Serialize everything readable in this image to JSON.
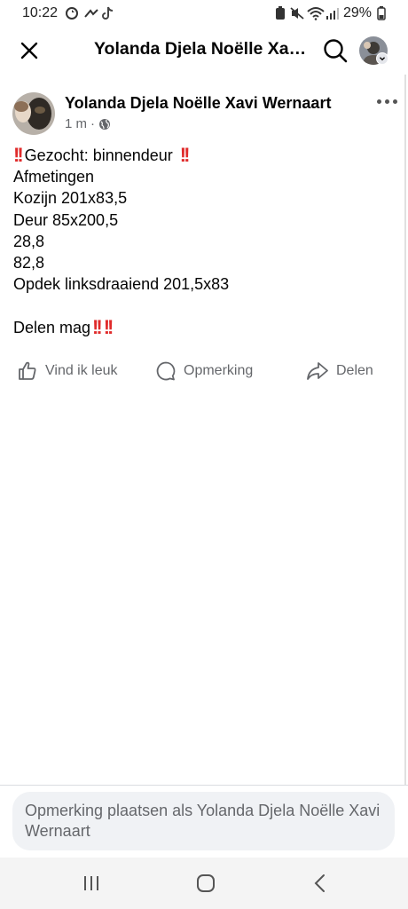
{
  "status_bar": {
    "time": "10:22",
    "battery": "29%",
    "icons": [
      "sync-icon",
      "missed-call-icon",
      "tiktok-icon",
      "battery-saver-icon",
      "mute-icon",
      "wifi-icon",
      "signal-icon",
      "battery-icon"
    ]
  },
  "header": {
    "title": "Yolanda Djela Noëlle Xavier Wernaart",
    "close_icon": "close-icon",
    "search_icon": "search-icon"
  },
  "post": {
    "author": "Yolanda Djela Noëlle Xavi Wernaart",
    "time": "1 m",
    "separator": "·",
    "privacy_icon": "globe-icon",
    "emoji_accent": "#e02b2b",
    "lines": [
      "Gezocht: binnendeur",
      "Afmetingen",
      "Kozijn 201x83,5",
      "Deur 85x200,5",
      "28,8",
      "82,8",
      "Opdek linksdraaiend 201,5x83",
      "",
      "Delen mag"
    ]
  },
  "actions": {
    "like": "Vind ik leuk",
    "comment": "Opmerking",
    "share": "Delen"
  },
  "comment_box": {
    "placeholder": "Opmerking plaatsen als Yolanda Djela Noëlle Xavi Wernaart"
  },
  "nav": {
    "recent_icon": "recent-apps-icon",
    "home_icon": "home-icon",
    "back_icon": "back-icon"
  }
}
